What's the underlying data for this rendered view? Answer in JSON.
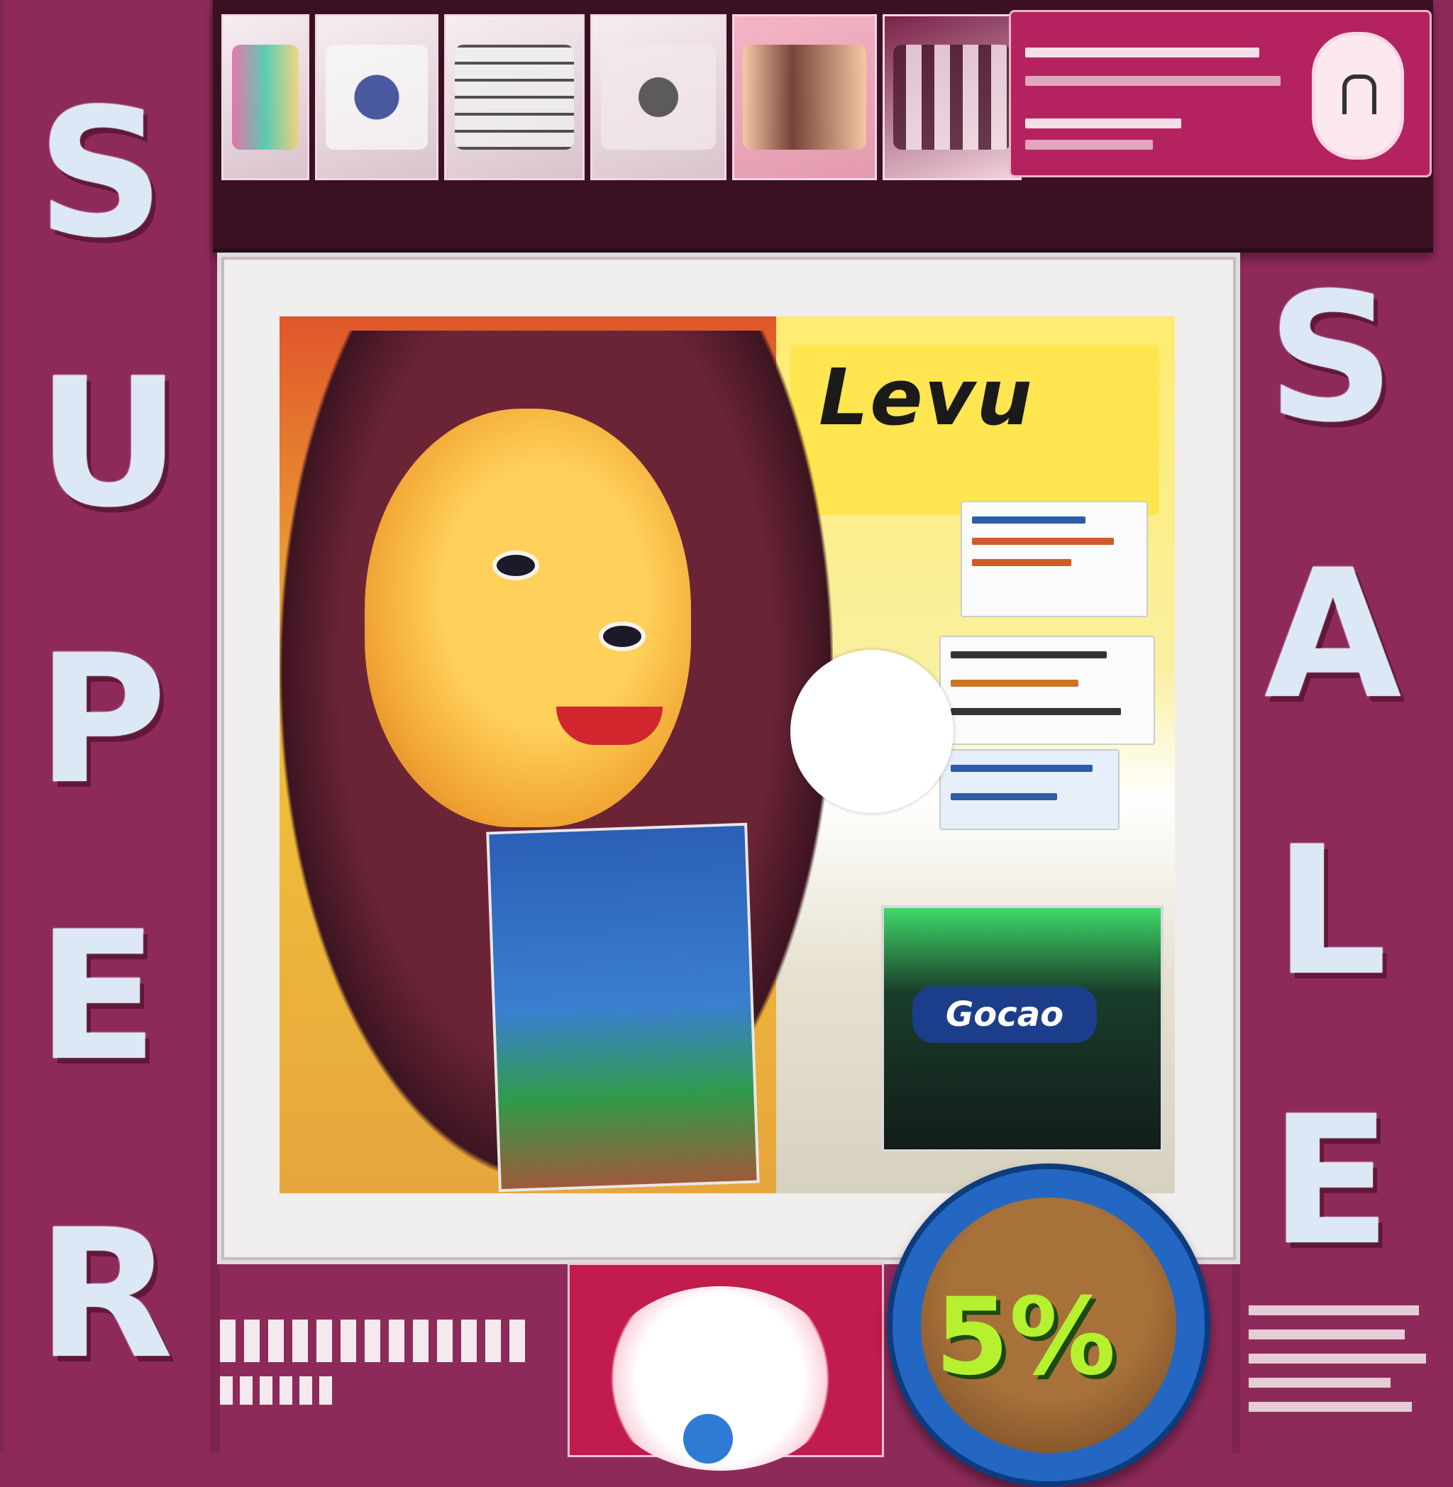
{
  "left_word": [
    "S",
    "U",
    "P",
    "E",
    "R"
  ],
  "right_word": [
    "S",
    "A",
    "L",
    "E"
  ],
  "photo_sign": "Levu",
  "pack_label": "Gocao",
  "discount_badge": "5%",
  "colors": {
    "background": "#8e2a5a",
    "letters": "#dde8f6",
    "shelf": "#3b1022",
    "frame": "#f1eeee",
    "disc": "#2367c2",
    "discount_text": "#b5f12e"
  }
}
